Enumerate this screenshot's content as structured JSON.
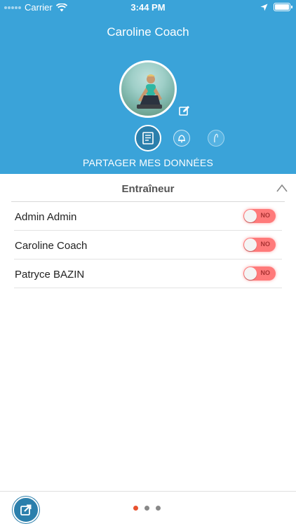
{
  "status_bar": {
    "carrier": "Carrier",
    "time": "3:44 PM",
    "battery_level": 1.0
  },
  "header": {
    "title": "Caroline Coach",
    "section_label": "PARTAGER MES DONNÉES"
  },
  "tabs": [
    {
      "icon": "notebook-icon",
      "active": true
    },
    {
      "icon": "bell-icon",
      "active": false
    },
    {
      "icon": "nutrition-icon",
      "active": false
    }
  ],
  "panel": {
    "title": "Entraîneur",
    "rows": [
      {
        "name": "Admin Admin",
        "toggle": "NO"
      },
      {
        "name": "Caroline Coach",
        "toggle": "NO"
      },
      {
        "name": "Patryce BAZIN",
        "toggle": "NO"
      }
    ]
  },
  "pagination": {
    "pages": 3,
    "current": 1
  },
  "colors": {
    "header": "#3aa3d9",
    "accent": "#2b7fac",
    "toggle_off": "#ff7a7a",
    "active_dot": "#e8522f"
  }
}
